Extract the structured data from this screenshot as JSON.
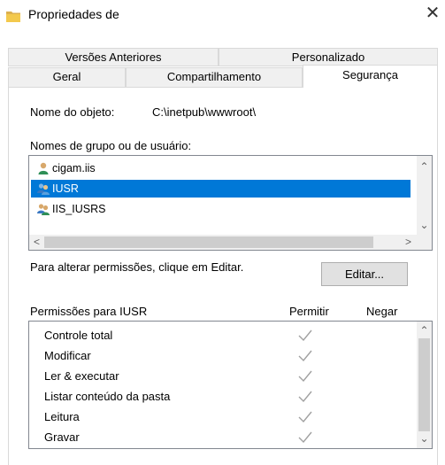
{
  "window": {
    "title": "Propriedades de",
    "close_glyph": "✕"
  },
  "tabs": {
    "row_back": [
      "Versões Anteriores",
      "Personalizado"
    ],
    "row_front": [
      "Geral",
      "Compartilhamento",
      "Segurança"
    ],
    "active": "Segurança"
  },
  "object": {
    "label": "Nome do objeto:",
    "value": "C:\\inetpub\\wwwroot\\"
  },
  "users": {
    "label": "Nomes de grupo ou de usuário:",
    "items": [
      {
        "name": "cigam.iis",
        "icon": "single-user-icon"
      },
      {
        "name": "IUSR",
        "icon": "group-users-icon",
        "selected": true
      },
      {
        "name": "IIS_IUSRS",
        "icon": "group-users-icon"
      }
    ]
  },
  "edit": {
    "hint": "Para alterar permissões, clique em Editar.",
    "button": "Editar..."
  },
  "permissions": {
    "label": "Permissões para IUSR",
    "col_allow": "Permitir",
    "col_deny": "Negar",
    "rows": [
      {
        "name": "Controle total",
        "allow": true
      },
      {
        "name": "Modificar",
        "allow": true
      },
      {
        "name": "Ler & executar",
        "allow": true
      },
      {
        "name": "Listar conteúdo da pasta",
        "allow": true
      },
      {
        "name": "Leitura",
        "allow": true
      },
      {
        "name": "Gravar",
        "allow": true
      }
    ]
  },
  "colors": {
    "selection": "#0078d7",
    "check": "#a0a0a0"
  }
}
